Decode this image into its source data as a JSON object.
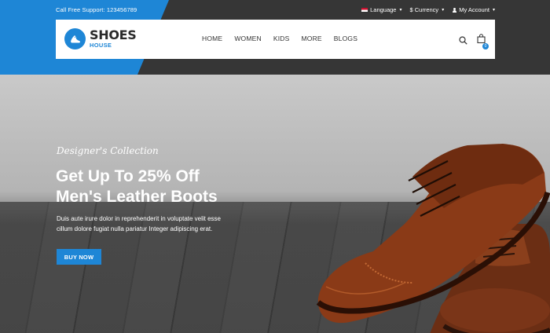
{
  "topbar": {
    "support_text": "Call Free Support: 123456789",
    "language": "Language",
    "currency": "$ Currency",
    "account": "My Account"
  },
  "brand": {
    "name": "SHOES",
    "sub": "HOUSE",
    "accent": "#1e86d6"
  },
  "nav": {
    "items": [
      "HOME",
      "WOMEN",
      "KIDS",
      "MORE",
      "BLOGS"
    ],
    "cart_count": "0"
  },
  "hero": {
    "script": "Designer's Collection",
    "title_line1": "Get Up To 25% Off",
    "title_line2": "Men's Leather Boots",
    "desc_line1": "Duis aute irure dolor in reprehenderit in voluptate velit esse",
    "desc_line2": "cillum dolore fugiat nulla pariatur Integer adipiscing erat.",
    "button": "BUY NOW"
  }
}
